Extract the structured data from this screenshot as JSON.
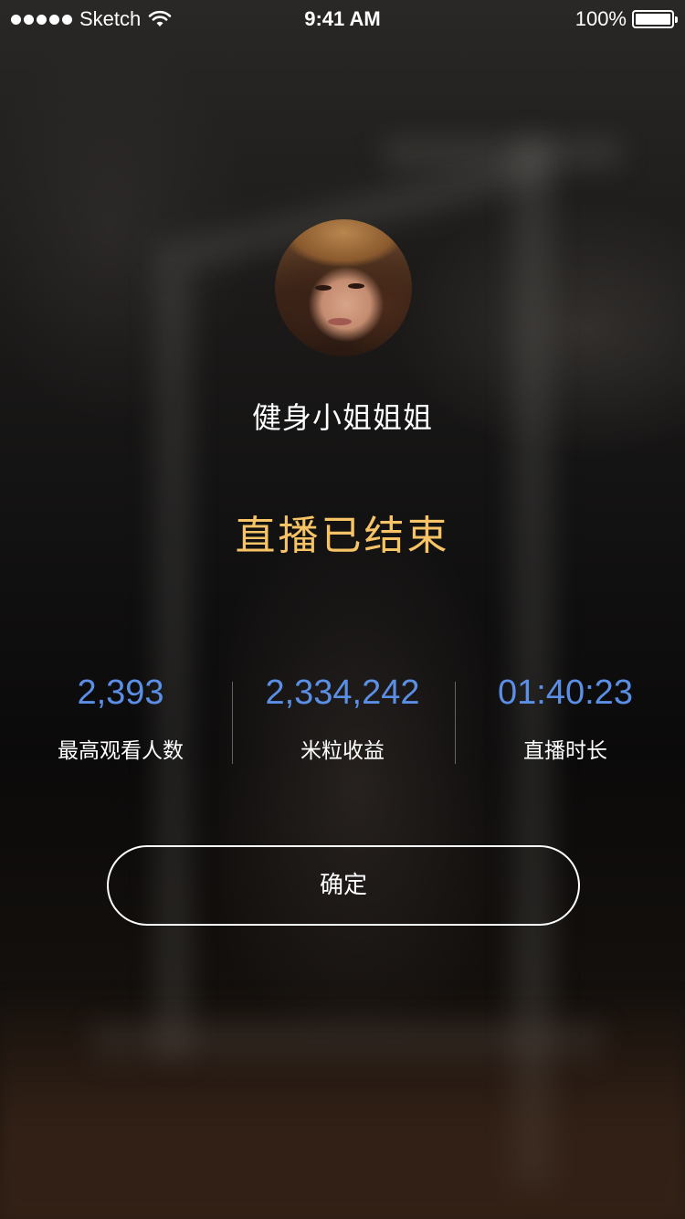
{
  "status_bar": {
    "carrier": "Sketch",
    "time": "9:41 AM",
    "battery": "100%",
    "icons": [
      "signal-dots-icon",
      "wifi-icon",
      "battery-icon"
    ]
  },
  "profile": {
    "username": "健身小姐姐姐",
    "avatar": "avatar-photo"
  },
  "live_ended": {
    "title": "直播已结束"
  },
  "stats": [
    {
      "value": "2,393",
      "label": "最高观看人数"
    },
    {
      "value": "2,334,242",
      "label": "米粒收益"
    },
    {
      "value": "01:40:23",
      "label": "直播时长"
    }
  ],
  "actions": {
    "confirm_label": "确定"
  },
  "colors": {
    "title_accent": "#f6c467",
    "stat_value": "#5b8fe6",
    "text": "#ffffff"
  }
}
